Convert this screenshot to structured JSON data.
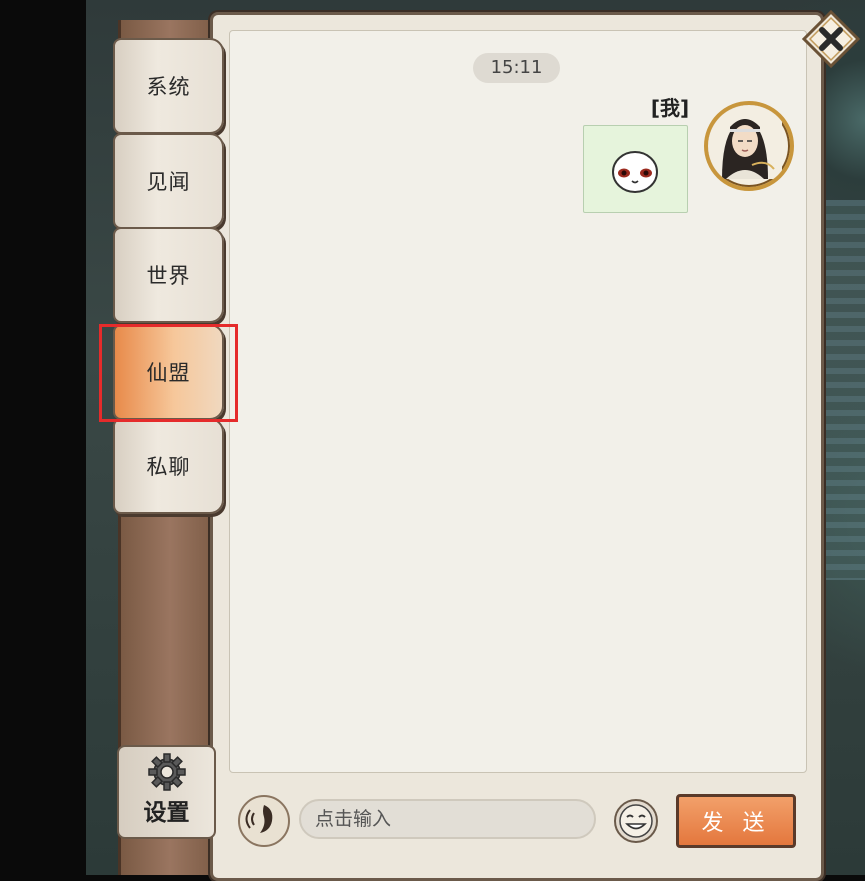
{
  "tabs": [
    {
      "label": "系统"
    },
    {
      "label": "见闻"
    },
    {
      "label": "世界"
    },
    {
      "label": "仙盟",
      "active": true
    },
    {
      "label": "私聊"
    }
  ],
  "settings": {
    "label": "设置"
  },
  "chat": {
    "timestamp": "15:11",
    "messages": [
      {
        "sender": "[我]",
        "content_type": "sticker"
      }
    ]
  },
  "input": {
    "placeholder": "点击输入"
  },
  "send_button": {
    "label": "发 送"
  },
  "colors": {
    "highlight": "#e52b2b",
    "active_tab": "#e88a4a",
    "send_button": "#e4773d",
    "bubble": "#e6f4dc"
  }
}
